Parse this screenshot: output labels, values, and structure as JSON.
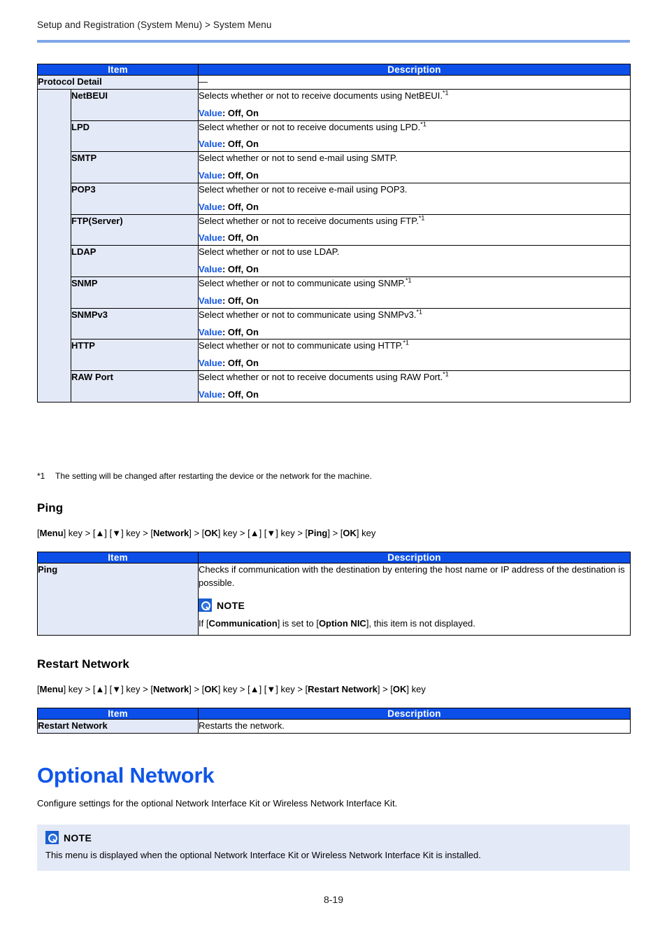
{
  "breadcrumb": "Setup and Registration (System Menu) > System Menu",
  "page_number": "8-19",
  "colors": {
    "table_header_blue": "#0b4fe8",
    "item_cell_blue": "#e4e9f7",
    "heading_blue": "#1056e8",
    "rule_blue": "#7ea6e8",
    "value_label_blue": "#1457e0"
  },
  "table_headers": {
    "item": "Item",
    "description": "Description"
  },
  "protocol_table": {
    "parent_row": {
      "item": "Protocol Detail",
      "description": "—"
    },
    "rows": [
      {
        "item": "NetBEUI",
        "desc": "Selects whether or not to receive documents using NetBEUI.",
        "footnote": "*1",
        "value_label": "Value",
        "value": ": Off, On"
      },
      {
        "item": "LPD",
        "desc": "Select whether or not to receive documents using LPD.",
        "footnote": "*1",
        "value_label": "Value",
        "value": ": Off, On"
      },
      {
        "item": "SMTP",
        "desc": "Select whether or not to send e-mail using SMTP.",
        "footnote": "",
        "value_label": "Value",
        "value": ": Off, On"
      },
      {
        "item": "POP3",
        "desc": "Select whether or not to receive e-mail using POP3.",
        "footnote": "",
        "value_label": "Value",
        "value": ": Off, On"
      },
      {
        "item": "FTP(Server)",
        "desc": "Select whether or not to receive documents using FTP.",
        "footnote": "*1",
        "value_label": "Value",
        "value": ": Off, On"
      },
      {
        "item": "LDAP",
        "desc": "Select whether or not to use LDAP.",
        "footnote": "",
        "value_label": "Value",
        "value": ": Off, On"
      },
      {
        "item": "SNMP",
        "desc": "Select whether or not to communicate using SNMP.",
        "footnote": "*1",
        "value_label": "Value",
        "value": ": Off, On"
      },
      {
        "item": "SNMPv3",
        "desc": "Select whether or not to communicate using SNMPv3.",
        "footnote": "*1",
        "value_label": "Value",
        "value": ": Off, On"
      },
      {
        "item": "HTTP",
        "desc": "Select whether or not to communicate using HTTP.",
        "footnote": "*1",
        "value_label": "Value",
        "value": ": Off, On"
      },
      {
        "item": "RAW Port",
        "desc": "Select whether or not to receive documents using RAW Port.",
        "footnote": "*1",
        "value_label": "Value",
        "value": ": Off, On"
      }
    ]
  },
  "footnote": {
    "mark": "*1",
    "text": "The setting will be changed after restarting the device or the network for the machine."
  },
  "ping_section": {
    "heading": "Ping",
    "keypath_parts": [
      {
        "t": "[",
        "b": false
      },
      {
        "t": "Menu",
        "b": true
      },
      {
        "t": "] key > [",
        "b": false
      },
      {
        "t": "▲",
        "b": true
      },
      {
        "t": "] [",
        "b": false
      },
      {
        "t": "▼",
        "b": true
      },
      {
        "t": "] key > [",
        "b": false
      },
      {
        "t": "Network",
        "b": true
      },
      {
        "t": "] > [",
        "b": false
      },
      {
        "t": "OK",
        "b": true
      },
      {
        "t": "] key > [",
        "b": false
      },
      {
        "t": "▲",
        "b": true
      },
      {
        "t": "] [",
        "b": false
      },
      {
        "t": "▼",
        "b": true
      },
      {
        "t": "] key > [",
        "b": false
      },
      {
        "t": "Ping",
        "b": true
      },
      {
        "t": "] > [",
        "b": false
      },
      {
        "t": "OK",
        "b": true
      },
      {
        "t": "] key",
        "b": false
      }
    ],
    "row": {
      "item": "Ping",
      "desc": "Checks if communication with the destination by entering the host name or IP address of the destination is possible.",
      "note_title": "NOTE",
      "note_parts": [
        {
          "t": "If [",
          "b": false
        },
        {
          "t": "Communication",
          "b": true
        },
        {
          "t": "] is set to [",
          "b": false
        },
        {
          "t": "Option NIC",
          "b": true
        },
        {
          "t": "], this item is not displayed.",
          "b": false
        }
      ]
    }
  },
  "restart_section": {
    "heading": "Restart Network",
    "keypath_parts": [
      {
        "t": "[",
        "b": false
      },
      {
        "t": "Menu",
        "b": true
      },
      {
        "t": "] key > [",
        "b": false
      },
      {
        "t": "▲",
        "b": true
      },
      {
        "t": "] [",
        "b": false
      },
      {
        "t": "▼",
        "b": true
      },
      {
        "t": "] key > [",
        "b": false
      },
      {
        "t": "Network",
        "b": true
      },
      {
        "t": "] > [",
        "b": false
      },
      {
        "t": "OK",
        "b": true
      },
      {
        "t": "] key > [",
        "b": false
      },
      {
        "t": "▲",
        "b": true
      },
      {
        "t": "] [",
        "b": false
      },
      {
        "t": "▼",
        "b": true
      },
      {
        "t": "] key > [",
        "b": false
      },
      {
        "t": "Restart Network",
        "b": true
      },
      {
        "t": "] > [",
        "b": false
      },
      {
        "t": "OK",
        "b": true
      },
      {
        "t": "] key",
        "b": false
      }
    ],
    "row": {
      "item": "Restart Network",
      "desc": "Restarts the network."
    }
  },
  "optional_network": {
    "heading": "Optional Network",
    "intro": "Configure settings for the optional Network Interface Kit or Wireless Network Interface Kit.",
    "note_title": "NOTE",
    "note_body": "This menu is displayed when the optional Network Interface Kit or Wireless Network Interface Kit is installed."
  }
}
